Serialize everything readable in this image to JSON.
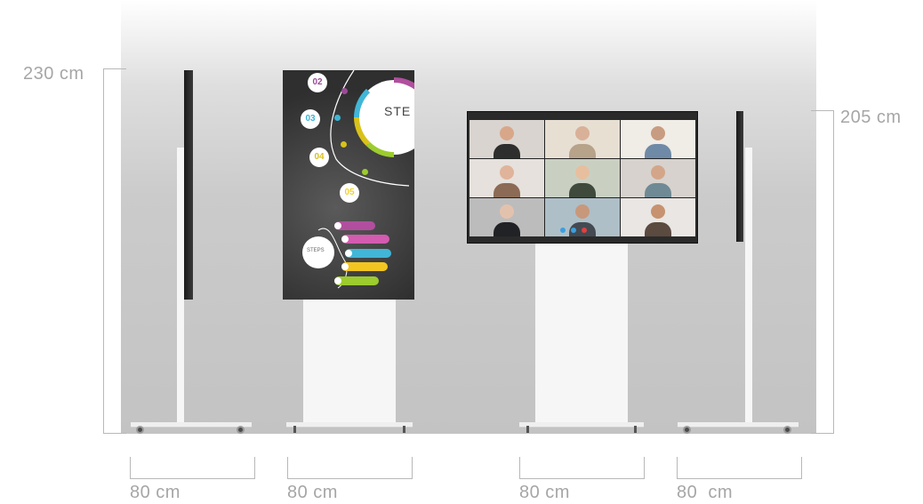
{
  "dimensions": {
    "height_left": "230 cm",
    "height_right": "205 cm",
    "widths": [
      "80 cm",
      "80 cm",
      "80 cm",
      "80  cm"
    ]
  },
  "portrait_screen": {
    "steps": [
      "02",
      "03",
      "04",
      "05"
    ],
    "ring_title": "STE",
    "lower_circle_label": "STEPS",
    "step_colors": [
      "#9c4a97",
      "#3db6d6",
      "#d8c21a",
      "#f1d32a"
    ],
    "pill_colors": [
      "#b14f9e",
      "#d35bb0",
      "#41b6d6",
      "#f2c521",
      "#9ccc2e"
    ]
  },
  "video_call": {
    "participants": 9,
    "controls_colors": [
      "#3aa0e0",
      "#3aa0e0",
      "#e04040"
    ]
  }
}
